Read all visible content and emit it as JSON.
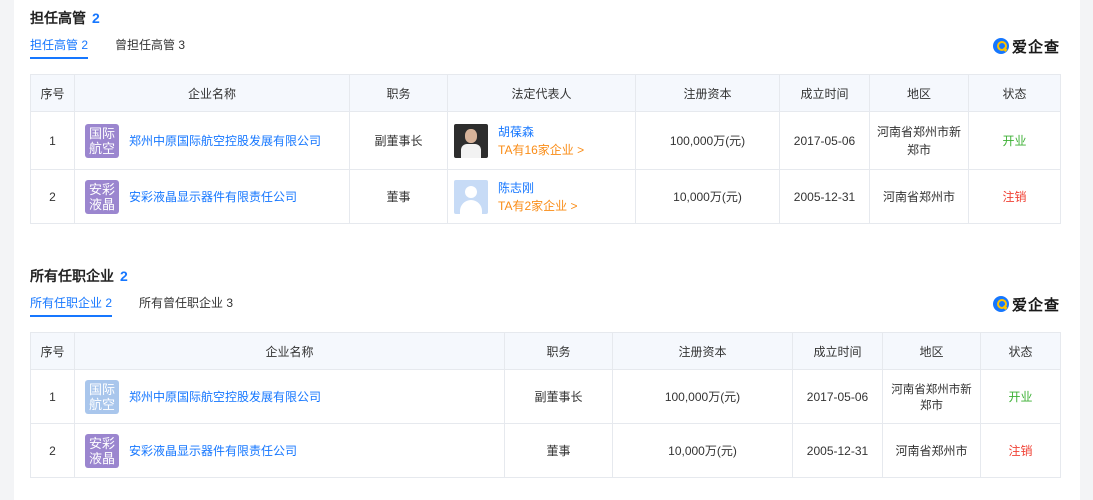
{
  "colors": {
    "accent": "#1677ff",
    "open": "#3cb034",
    "closed": "#f04134",
    "orange": "#fa8c16"
  },
  "brand": {
    "name": "爱企查",
    "icon": "magnifier-q-icon"
  },
  "section1": {
    "title": "担任高管",
    "count": "2",
    "tabs": [
      {
        "label": "担任高管 2",
        "active": true
      },
      {
        "label": "曾担任高管 3",
        "active": false
      }
    ],
    "headers": [
      "序号",
      "企业名称",
      "职务",
      "法定代表人",
      "注册资本",
      "成立时间",
      "地区",
      "状态"
    ],
    "rows": [
      {
        "index": "1",
        "logo": [
          "国际",
          "航空"
        ],
        "company": "郑州中原国际航空控股发展有限公司",
        "position": "副董事长",
        "rep_name": "胡葆森",
        "rep_extra": "TA有16家企业 >",
        "capital": "100,000万(元)",
        "date": "2017-05-06",
        "region": "河南省郑州市新郑市",
        "status": "开业"
      },
      {
        "index": "2",
        "logo": [
          "安彩",
          "液晶"
        ],
        "company": "安彩液晶显示器件有限责任公司",
        "position": "董事",
        "rep_name": "陈志刚",
        "rep_extra": "TA有2家企业 >",
        "capital": "10,000万(元)",
        "date": "2005-12-31",
        "region": "河南省郑州市",
        "status": "注销"
      }
    ]
  },
  "section2": {
    "title": "所有任职企业",
    "count": "2",
    "tabs": [
      {
        "label": "所有任职企业 2",
        "active": true
      },
      {
        "label": "所有曾任职企业 3",
        "active": false
      }
    ],
    "headers": [
      "序号",
      "企业名称",
      "职务",
      "注册资本",
      "成立时间",
      "地区",
      "状态"
    ],
    "rows": [
      {
        "index": "1",
        "logo": [
          "国际",
          "航空"
        ],
        "company": "郑州中原国际航空控股发展有限公司",
        "position": "副董事长",
        "capital": "100,000万(元)",
        "date": "2017-05-06",
        "region": "河南省郑州市新郑市",
        "status": "开业"
      },
      {
        "index": "2",
        "logo": [
          "安彩",
          "液晶"
        ],
        "company": "安彩液晶显示器件有限责任公司",
        "position": "董事",
        "capital": "10,000万(元)",
        "date": "2005-12-31",
        "region": "河南省郑州市",
        "status": "注销"
      }
    ]
  }
}
